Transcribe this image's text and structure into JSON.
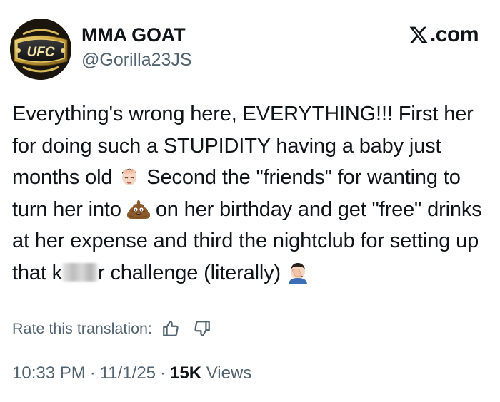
{
  "author": {
    "display_name": "MMA GOAT",
    "handle": "@Gorilla23JS",
    "avatar_logo_text": "UFC"
  },
  "brand": {
    "logo_text": ".com",
    "logo_icon": "x-logo-icon"
  },
  "tweet": {
    "segments": [
      "Everything's wrong here, EVERYTHING!!! First her for doing such a STUPIDITY having a baby just months old",
      "Second the \"friends\" for wanting to turn her into",
      "on her birthday and get \"free\" drinks at her expense and third the nightclub for setting up that k",
      "r challenge (literally)"
    ],
    "emojis": [
      "face-palm-icon",
      "pile-of-poo-icon",
      "man-facepalming-icon"
    ],
    "censored": true
  },
  "translation": {
    "prompt": "Rate this translation:",
    "icons": [
      "thumbs-up-icon",
      "thumbs-down-icon"
    ]
  },
  "meta": {
    "time": "10:33 PM",
    "separator": "·",
    "date": "11/1/25",
    "views_count": "15K",
    "views_label": "Views"
  },
  "colors": {
    "text_primary": "#0f1419",
    "text_secondary": "#536471",
    "background": "#ffffff"
  }
}
